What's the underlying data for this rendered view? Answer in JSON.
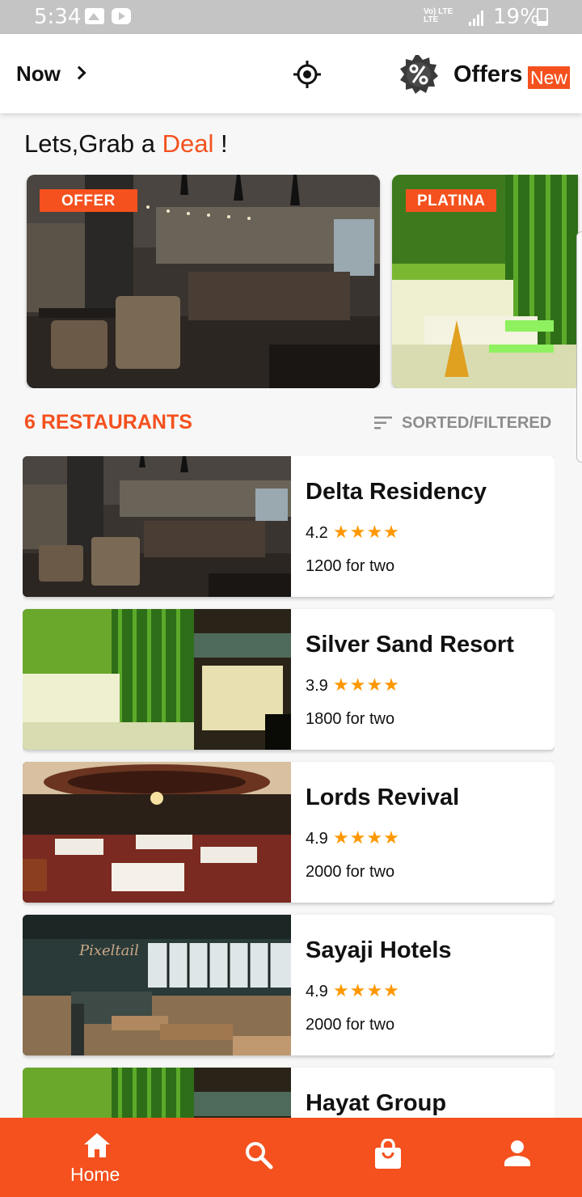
{
  "status_bar": {
    "time": "5:34",
    "network_top": "Vo) LTE",
    "network_bottom": "LTE",
    "battery": "19%"
  },
  "header": {
    "now_label": "Now",
    "offers_label": "Offers",
    "new_tag": "New",
    "icons": [
      "chevron-right-icon",
      "locate-icon",
      "discount-badge-icon"
    ]
  },
  "deal": {
    "prefix": "Lets,Grab a ",
    "accent": "Deal",
    "suffix": " !"
  },
  "carousel": [
    {
      "tag": "OFFER"
    },
    {
      "tag": "PLATINA"
    }
  ],
  "restaurants_header": {
    "count_label": "6 RESTAURANTS",
    "sort_label": "SORTED/FILTERED"
  },
  "restaurants": [
    {
      "name": "Delta Residency",
      "rating": "4.2",
      "stars": "★★★★",
      "price": "1200 for two"
    },
    {
      "name": "Silver Sand Resort",
      "rating": "3.9",
      "stars": "★★★★",
      "price": "1800 for two"
    },
    {
      "name": "Lords Revival",
      "rating": "4.9",
      "stars": "★★★★",
      "price": "2000 for two"
    },
    {
      "name": "Sayaji Hotels",
      "rating": "4.9",
      "stars": "★★★★",
      "price": "2000 for two"
    },
    {
      "name": "Hayat Group",
      "rating": "",
      "stars": "",
      "price": ""
    }
  ],
  "bottom_nav": {
    "home_label": "Home",
    "icons": [
      "home-icon",
      "search-icon",
      "shopping-bag-icon",
      "profile-icon"
    ]
  },
  "colors": {
    "accent": "#f4511e",
    "star": "#ff9800",
    "muted": "#8d8d8d"
  }
}
